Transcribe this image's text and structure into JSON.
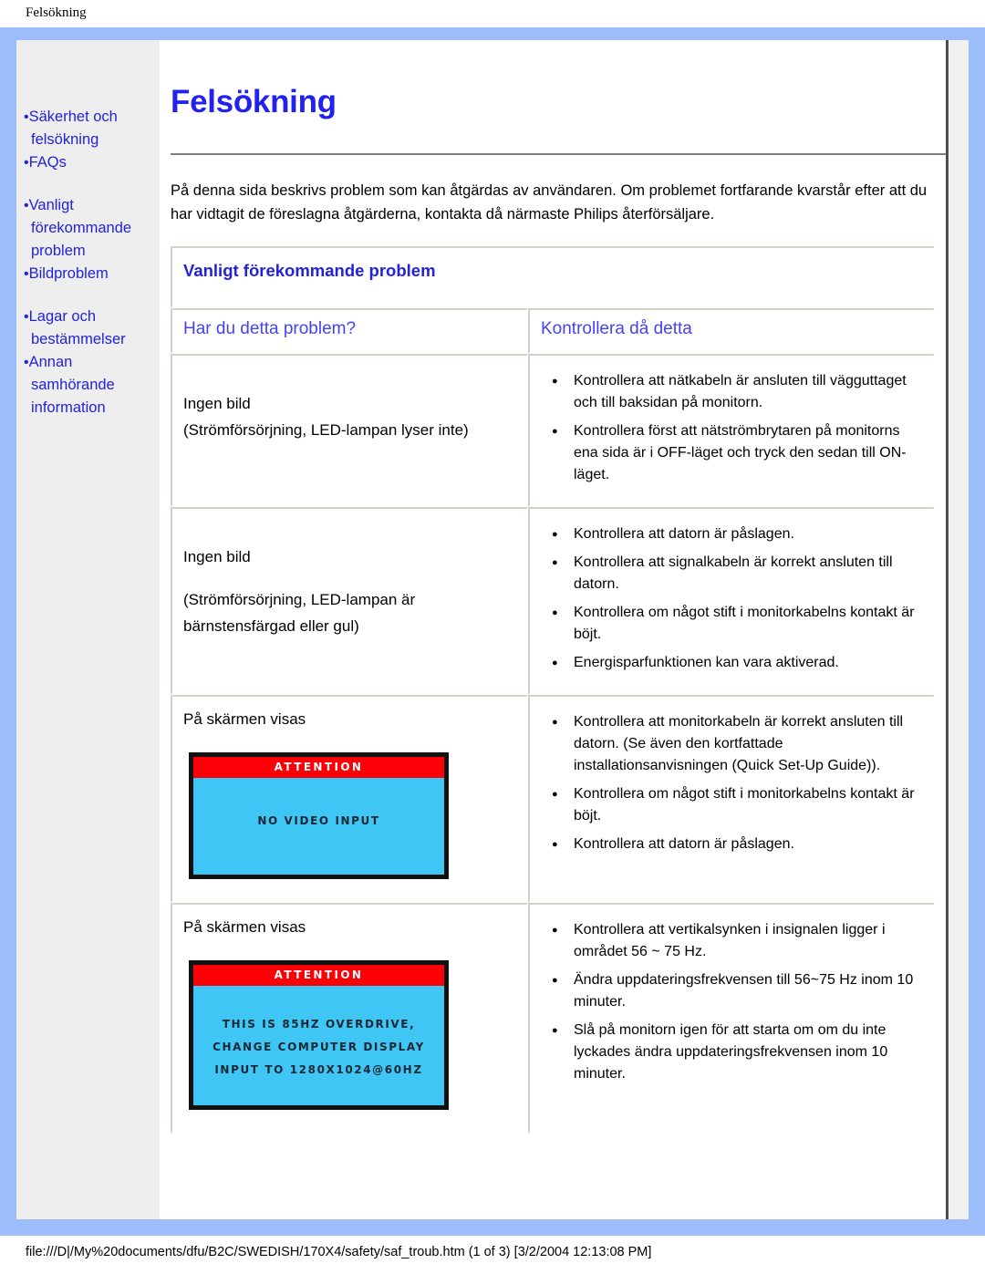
{
  "browser": {
    "header_title": "Felsökning",
    "footer_path": "file:///D|/My%20documents/dfu/B2C/SWEDISH/170X4/safety/saf_troub.htm (1 of 3) [3/2/2004 12:13:08 PM]"
  },
  "colors": {
    "page_border": "#9cbcfa",
    "sidebar_bg": "#eeeeee",
    "link_blue": "#2222dd",
    "heading_blue": "#2222ee",
    "column_head_blue": "#4444ee",
    "osd_red": "#fb0007",
    "osd_cyan": "#3fc6f5"
  },
  "sidebar": {
    "groups": [
      {
        "items": [
          {
            "label": "Säkerhet och felsökning"
          },
          {
            "label": "FAQs"
          }
        ]
      },
      {
        "items": [
          {
            "label": "Vanligt förekommande problem"
          },
          {
            "label": "Bildproblem"
          }
        ]
      },
      {
        "items": [
          {
            "label": "Lagar och bestämmelser"
          },
          {
            "label": "Annan samhörande information"
          }
        ]
      }
    ],
    "bullet": "•"
  },
  "main": {
    "title": "Felsökning",
    "intro": "På denna sida beskrivs problem som kan åtgärdas av användaren. Om problemet fortfarande kvarstår efter att du har vidtagit de föreslagna åtgärderna, kontakta då närmaste Philips återförsäljare."
  },
  "table": {
    "banner": "Vanligt förekommande problem",
    "col_problem": "Har du detta problem?",
    "col_check": "Kontrollera då detta",
    "rows": [
      {
        "problem_line1": "Ingen bild",
        "problem_line2": "(Strömförsörjning, LED-lampan lyser inte)",
        "fixes": [
          "Kontrollera att nätkabeln är ansluten till vägguttaget och till baksidan på monitorn.",
          "Kontrollera först att nätströmbrytaren på monitorns ena sida är i OFF-läget och tryck den sedan till ON-läget."
        ]
      },
      {
        "problem_line1": "Ingen bild",
        "problem_line2": "(Strömförsörjning, LED-lampan är bärnstensfärgad eller gul)",
        "fixes": [
          "Kontrollera att datorn är påslagen.",
          "Kontrollera att signalkabeln är korrekt ansluten till datorn.",
          "Kontrollera om något stift i monitorkabelns kontakt är böjt.",
          "Energisparfunktionen kan vara aktiverad."
        ]
      },
      {
        "problem_line1": "På skärmen visas",
        "osd": {
          "title": "ATTENTION",
          "lines": [
            "NO VIDEO INPUT"
          ]
        },
        "fixes": [
          "Kontrollera att monitorkabeln är korrekt ansluten till datorn. (Se även den kortfattade installationsanvisningen (Quick Set-Up Guide)).",
          "Kontrollera om något stift i monitorkabelns kontakt är böjt.",
          "Kontrollera att datorn är påslagen."
        ]
      },
      {
        "problem_line1": "På skärmen visas",
        "osd": {
          "title": "ATTENTION",
          "lines": [
            "THIS IS 85HZ OVERDRIVE,",
            "CHANGE COMPUTER DISPLAY",
            "INPUT TO 1280X1024@60HZ"
          ]
        },
        "fixes": [
          "Kontrollera att vertikalsynken i insignalen ligger i området 56 ~ 75 Hz.",
          "Ändra uppdateringsfrekvensen till 56~75 Hz inom 10 minuter.",
          "Slå på monitorn igen för att starta om om du inte lyckades ändra uppdateringsfrekvensen inom 10 minuter."
        ]
      }
    ]
  }
}
